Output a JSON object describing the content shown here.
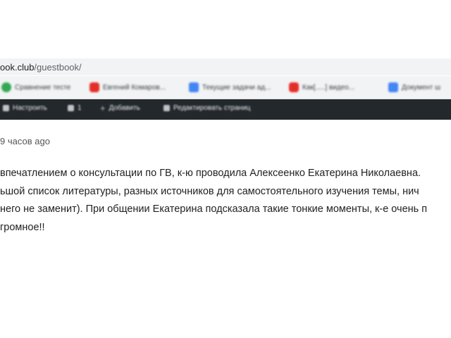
{
  "browser": {
    "url_host": "ook.club",
    "url_path": "/guestbook/",
    "bookmarks": [
      {
        "label": "Сравнение тесте",
        "icon": "green-circle-icon"
      },
      {
        "label": "Евгений Комаров...",
        "icon": "youtube-icon"
      },
      {
        "label": "Текущие задачи ад...",
        "icon": "google-docs-icon"
      },
      {
        "label": "Как[.....] видео...",
        "icon": "youtube-icon"
      },
      {
        "label": "Документ ш",
        "icon": "google-docs-icon"
      }
    ]
  },
  "admin_bar": {
    "customize_label": "Настроить",
    "comments_count": "1",
    "add_label": "Добавить",
    "edit_page_label": "Редактировать страниц"
  },
  "post": {
    "timestamp": "9 часов ago",
    "lines": [
      "впечатлением о консультации по ГВ, к-ю проводила Алексеенко Екатерина Николаевна.",
      "ьшой список литературы, разных источников для самостоятельного изучения темы, нич",
      "него не заменит). При общении Екатерина подсказала такие тонкие моменты, к-е очень п",
      "громное!!"
    ]
  }
}
